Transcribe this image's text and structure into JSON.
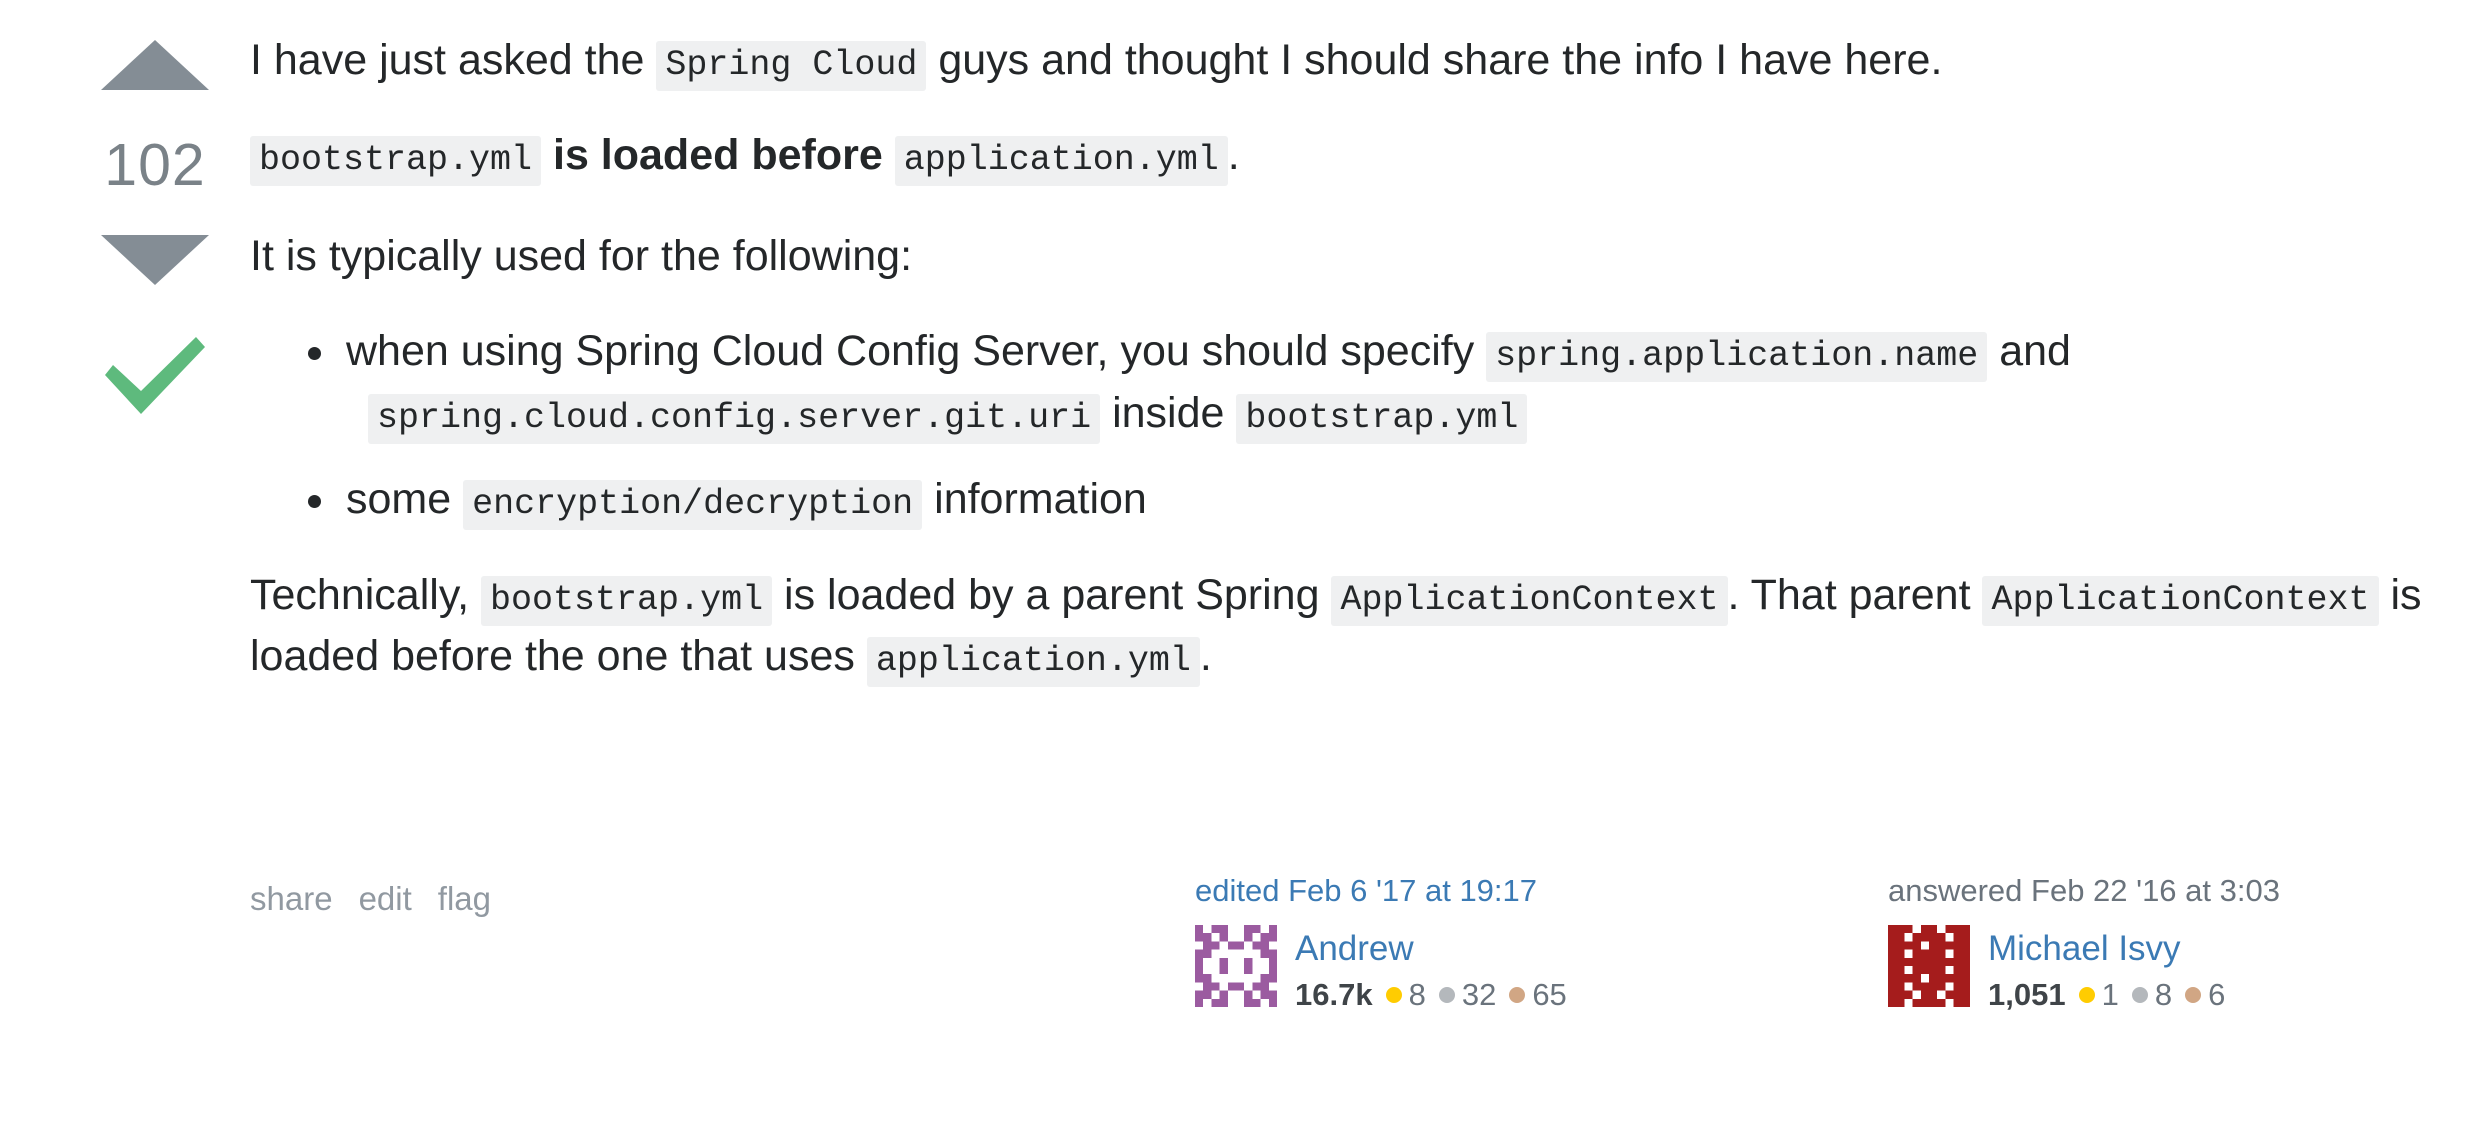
{
  "vote": {
    "upvote_label": "upvote",
    "score": "102",
    "downvote_label": "downvote",
    "accepted_label": "accepted answer",
    "arrow_color": "#848d95",
    "check_color": "#5eba7d"
  },
  "body": {
    "p1": {
      "t1": "I have just asked the ",
      "c1": "Spring Cloud",
      "t2": " guys and thought I should share the info I have here."
    },
    "p2": {
      "c1": "bootstrap.yml",
      "b1": "is loaded before",
      "c2": "application.yml",
      "t1": "."
    },
    "p3": {
      "t1": "It is typically used for the following:"
    },
    "bullets": [
      {
        "t1": "when using Spring Cloud Config Server, you should specify ",
        "c1": "spring.application.name",
        "t2": " and ",
        "c2": "spring.cloud.config.server.git.uri",
        "t3": " inside ",
        "c3": "bootstrap.yml"
      },
      {
        "t1": "some ",
        "c1": "encryption/decryption",
        "t2": " information"
      }
    ],
    "p4": {
      "t1": "Technically, ",
      "c1": "bootstrap.yml",
      "t2": " is loaded by a parent Spring ",
      "c2": "ApplicationContext",
      "t3": ". That parent ",
      "c3": "ApplicationContext",
      "t4": " is loaded before the one that uses ",
      "c4": "application.yml",
      "t5": "."
    }
  },
  "post_menu": {
    "share": "share",
    "edit": "edit",
    "flag": "flag"
  },
  "signatures": {
    "editor": {
      "action": "edited Feb 6 '17 at 19:17",
      "username": "Andrew",
      "reputation": "16.7k",
      "gold": "8",
      "silver": "32",
      "bronze": "65",
      "avatar_color": "#9b5ba0"
    },
    "answerer": {
      "action": "answered Feb 22 '16 at 3:03",
      "username": "Michael Isvy",
      "reputation": "1,051",
      "gold": "1",
      "silver": "8",
      "bronze": "6",
      "avatar_color": "#a51c1c"
    }
  }
}
